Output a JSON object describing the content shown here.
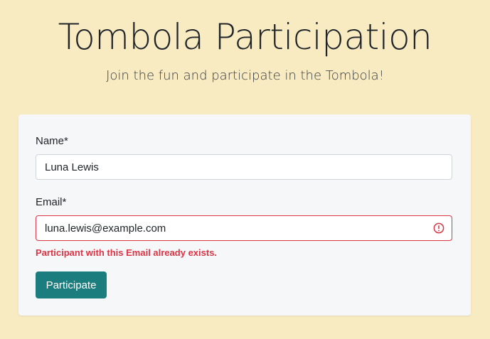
{
  "header": {
    "title": "Tombola Participation",
    "subtitle": "Join the fun and participate in the Tombola!"
  },
  "form": {
    "name_label": "Name*",
    "name_value": "Luna Lewis",
    "email_label": "Email*",
    "email_value": "luna.lewis@example.com",
    "email_error": "Participant with this Email already exists.",
    "error_icon": "exclamation-circle-icon",
    "submit_label": "Participate"
  },
  "colors": {
    "page_background": "#f8ebc2",
    "card_background": "#f6f7f9",
    "error": "#dc3545",
    "button": "#1b7d7d"
  }
}
